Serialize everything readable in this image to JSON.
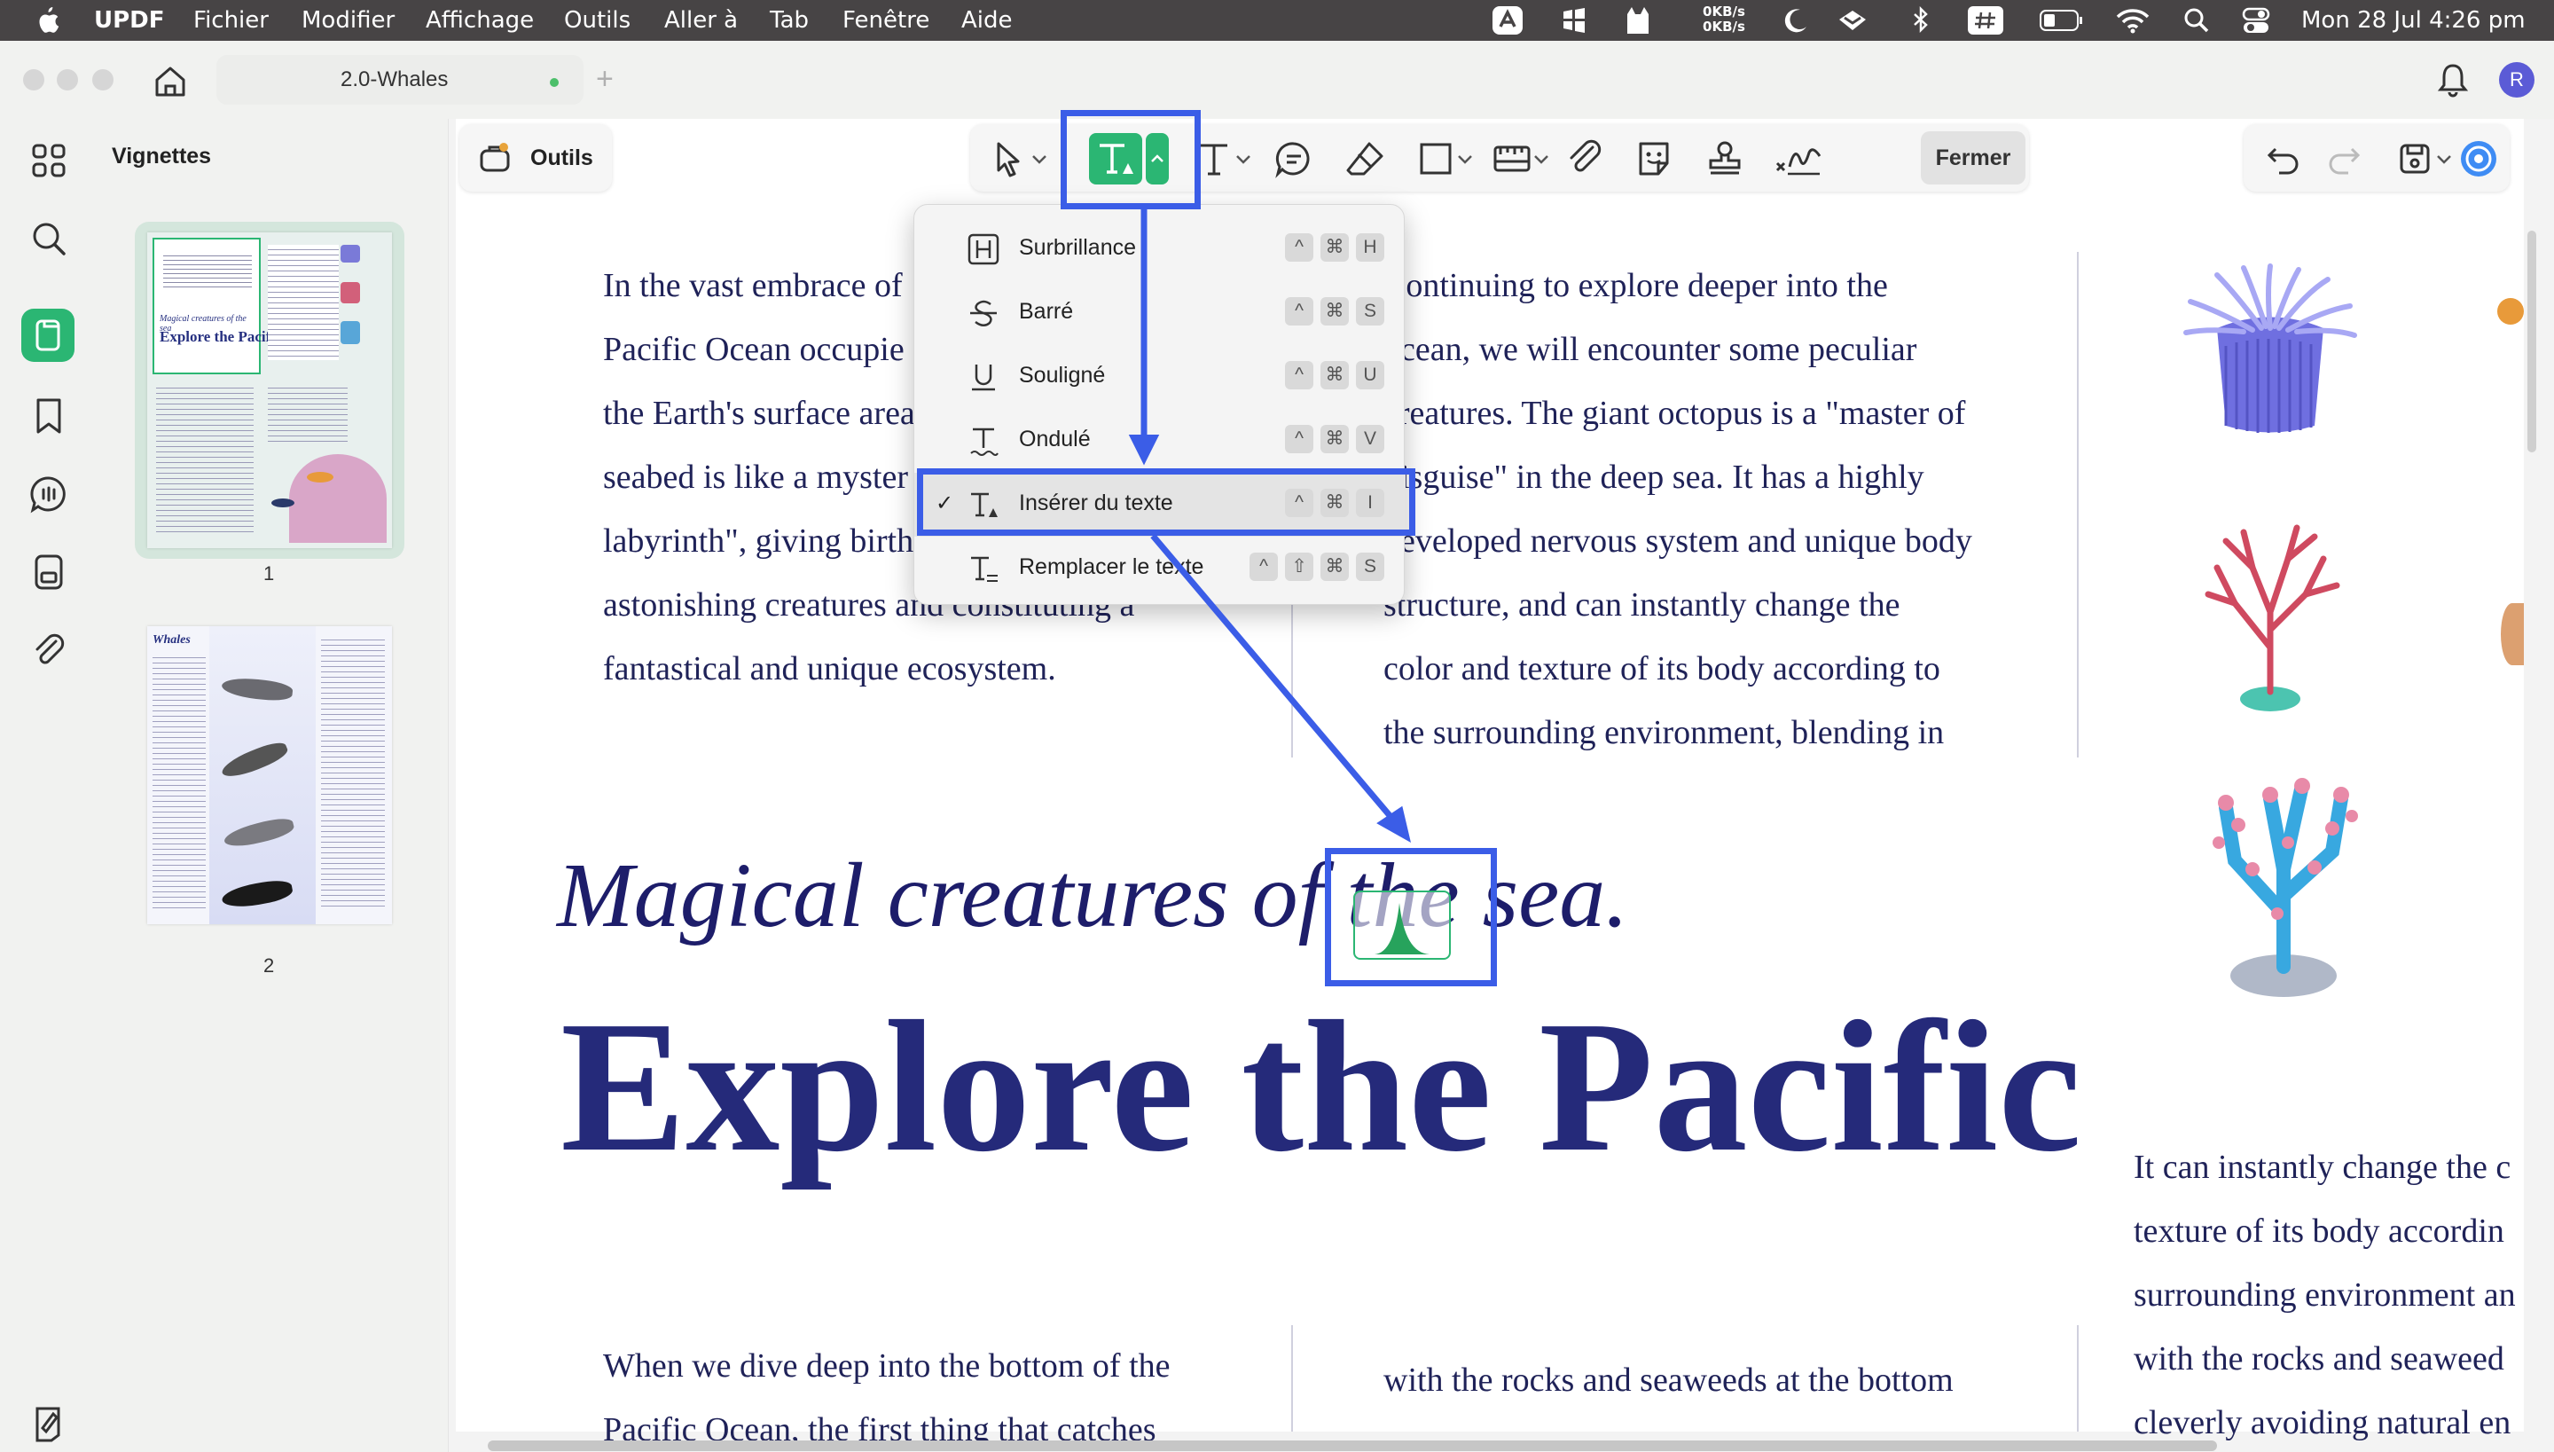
{
  "menubar": {
    "app": "UPDF",
    "items": [
      "Fichier",
      "Modifier",
      "Affichage",
      "Outils",
      "Aller à",
      "Tab",
      "Fenêtre",
      "Aide"
    ],
    "net_up": "0KB/s",
    "net_down": "0KB/s",
    "clock": "Mon 28 Jul  4:26 pm"
  },
  "window": {
    "tab_title": "2.0-Whales",
    "avatar_initial": "R"
  },
  "sidebar": {
    "title": "Vignettes",
    "pages": [
      "1",
      "2"
    ]
  },
  "toolbar": {
    "tools_label": "Outils",
    "close_label": "Fermer"
  },
  "dropdown": {
    "items": [
      {
        "label": "Surbrillance",
        "keys": [
          "^",
          "⌘",
          "H"
        ],
        "checked": false
      },
      {
        "label": "Barré",
        "keys": [
          "^",
          "⌘",
          "S"
        ],
        "checked": false
      },
      {
        "label": "Souligné",
        "keys": [
          "^",
          "⌘",
          "U"
        ],
        "checked": false
      },
      {
        "label": "Ondulé",
        "keys": [
          "^",
          "⌘",
          "V"
        ],
        "checked": false
      },
      {
        "label": "Insérer du texte",
        "keys": [
          "^",
          "⌘",
          "I"
        ],
        "checked": true
      },
      {
        "label": "Remplacer le texte",
        "keys": [
          "^",
          "⇧",
          "⌘",
          "S"
        ],
        "checked": false
      }
    ],
    "check": "✓"
  },
  "document": {
    "col1": [
      "In the vast embrace of",
      "Pacific Ocean occupie",
      "the Earth's surface area",
      "seabed is like a myster",
      "labyrinth\", giving birth",
      "astonishing creatures and constituting a",
      "fantastical and unique ecosystem."
    ],
    "col2": [
      "Continuing to explore deeper into the",
      "ocean, we will encounter some peculiar",
      "creatures. The giant octopus is a \"master of",
      "disguise\" in the deep sea. It has a highly",
      "developed nervous system and unique body",
      "structure, and can instantly change the",
      "color and texture of its body according to",
      "the surrounding environment, blending in"
    ],
    "subtitle": "Magical creatures of the sea.",
    "title": "Explore the Pacific",
    "col3": [
      "It can instantly change the c",
      "texture of its body accordin",
      "surrounding environment an",
      "with the rocks and seaweed",
      "cleverly avoiding natural en"
    ],
    "bottom_left": [
      "When we dive deep into the bottom of the",
      "Pacific Ocean, the first thing that catches"
    ],
    "bottom_mid": "with the rocks and seaweeds at the bottom"
  },
  "thumb1": {
    "title_small": "Magical creatures of the sea",
    "title": "Explore the Pacific"
  },
  "thumb2": {
    "title": "Whales"
  },
  "colors": {
    "accent": "#2bb673",
    "annotation": "#3b5de7",
    "title": "#252a7a"
  }
}
